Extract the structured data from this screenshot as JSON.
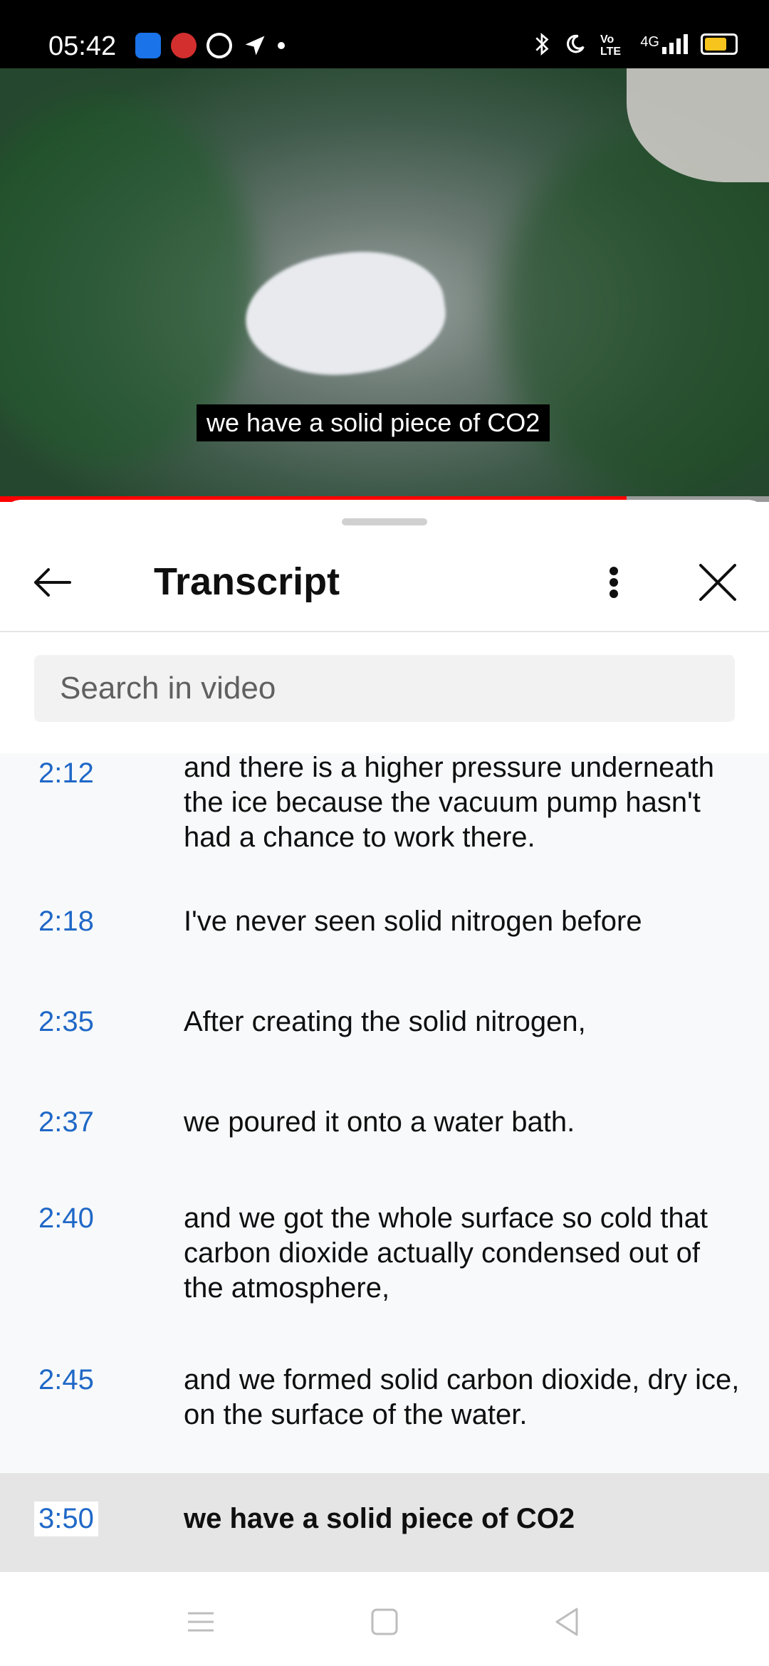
{
  "status_bar": {
    "time": "05:42",
    "left_icons": [
      "android-icon",
      "jio-icon",
      "app-icon",
      "location-icon",
      "dot-icon"
    ],
    "right_icons": [
      "bluetooth-icon",
      "moon-icon",
      "volte-icon",
      "signal-4g-icon",
      "battery-icon"
    ],
    "network": "4G"
  },
  "video": {
    "subtitle": "we have a solid piece of CO2",
    "progress_fraction": 0.815
  },
  "transcript_panel": {
    "title": "Transcript",
    "search_placeholder": "Search in video",
    "entries": [
      {
        "time": "2:12",
        "text": "and there is a higher pressure underneath the ice because the vacuum pump hasn't had a chance to work there."
      },
      {
        "time": "2:18",
        "text": "I've never seen solid nitrogen before"
      },
      {
        "time": "2:35",
        "text": "After creating the solid nitrogen,"
      },
      {
        "time": "2:37",
        "text": "we poured it onto a water bath."
      },
      {
        "time": "2:40",
        "text": "and we got the whole surface so cold that carbon dioxide actually condensed out of the atmosphere,"
      },
      {
        "time": "2:45",
        "text": "and we formed solid carbon dioxide, dry ice, on the surface of the water."
      },
      {
        "time": "3:50",
        "text": "we have a solid piece of CO2",
        "active": true
      }
    ]
  },
  "colors": {
    "timestamp": "#1f68c7",
    "progress": "#ff0000",
    "active_row": "#e5e5e5",
    "list_bg": "#f8f9fa"
  }
}
